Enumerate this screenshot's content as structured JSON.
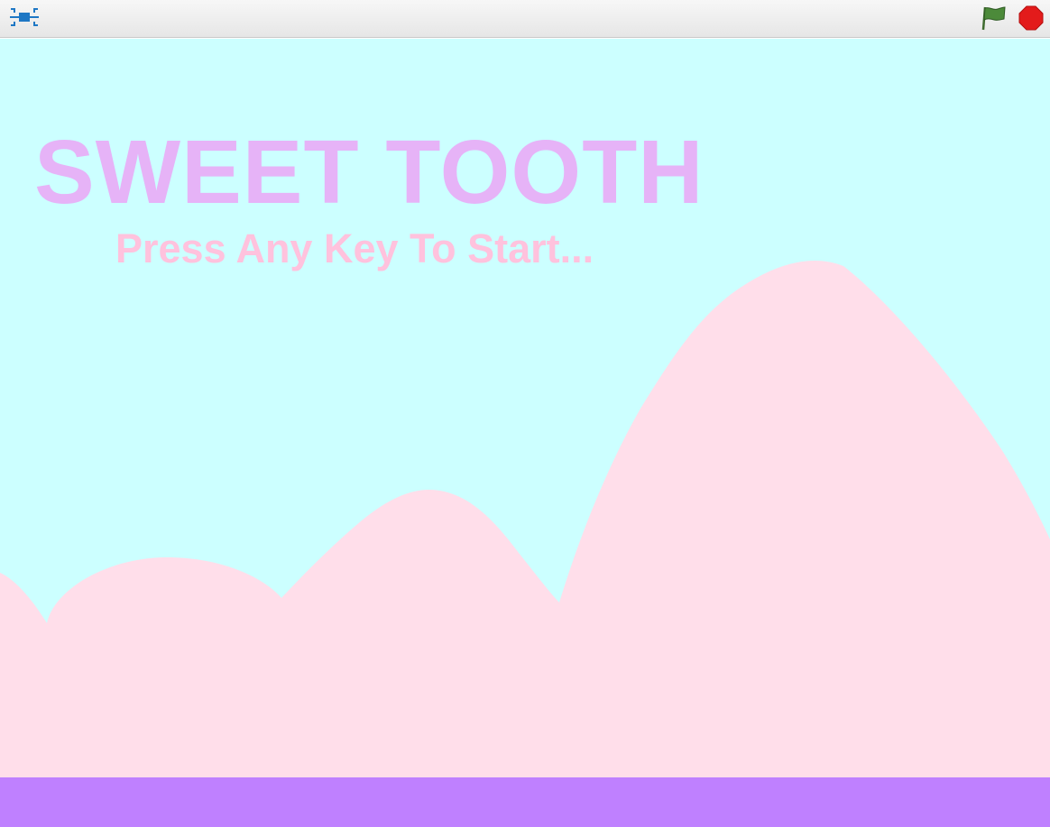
{
  "toolbar": {
    "fullscreen_icon": "fullscreen-toggle-icon",
    "green_flag_icon": "green-flag-icon",
    "stop_icon": "stop-sign-icon"
  },
  "game": {
    "title": "SWEET TOOTH",
    "prompt": "Press Any Key To Start..."
  },
  "colors": {
    "sky": "#ccffff",
    "hills": "#ffdeea",
    "ground": "#bf80ff",
    "title": "#e6b3f7",
    "prompt": "#ffc2dd",
    "flag": "#4c8a3a",
    "stop": "#e31b1b",
    "fullscreen": "#1e77c4"
  }
}
